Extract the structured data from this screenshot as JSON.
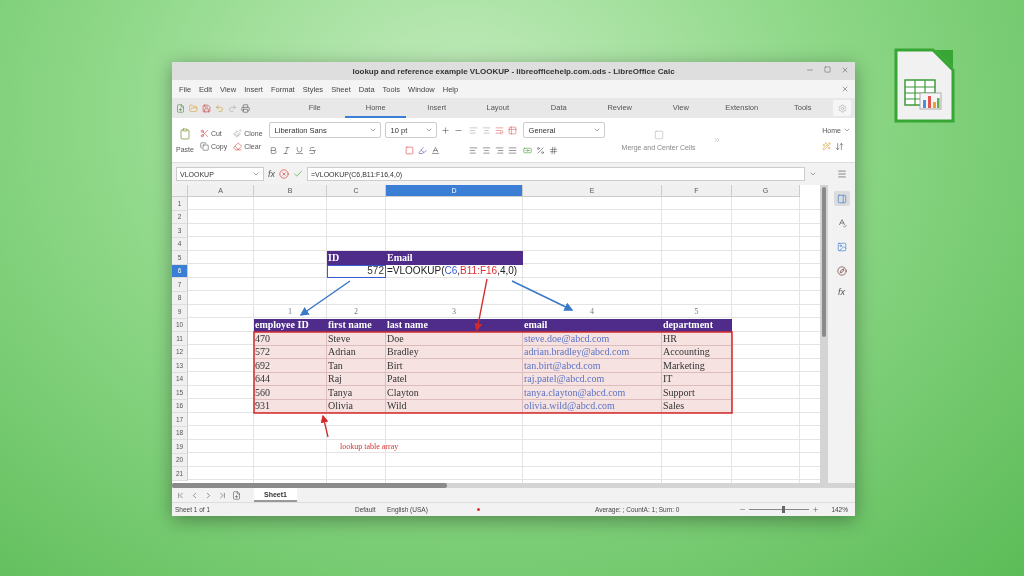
{
  "window": {
    "title": "lookup and reference example VLOOKUP - libreofficehelp.com.ods - LibreOffice Calc"
  },
  "menu": [
    "File",
    "Edit",
    "View",
    "Insert",
    "Format",
    "Styles",
    "Sheet",
    "Data",
    "Tools",
    "Window",
    "Help"
  ],
  "ribbon_tabs": [
    {
      "label": "File",
      "selected": false
    },
    {
      "label": "Home",
      "selected": true
    },
    {
      "label": "Insert",
      "selected": false
    },
    {
      "label": "Layout",
      "selected": false
    },
    {
      "label": "Data",
      "selected": false
    },
    {
      "label": "Review",
      "selected": false
    },
    {
      "label": "View",
      "selected": false
    },
    {
      "label": "Extension",
      "selected": false
    },
    {
      "label": "Tools",
      "selected": false
    }
  ],
  "ribbon": {
    "paste": "Paste",
    "cut": "Cut",
    "copy": "Copy",
    "clone": "Clone",
    "clear": "Clear",
    "font": "Liberation Sans",
    "size": "10 pt",
    "number_format": "General",
    "merge": "Merge and Center Cells",
    "context": "Home"
  },
  "formula_bar": {
    "name_box": "VLOOKUP",
    "function_label": "fx",
    "formula": "=VLOOKUP(C6,B11:F16,4,0)"
  },
  "sidebar": {
    "function_label": "fx"
  },
  "columns": [
    {
      "label": "A",
      "selected": false
    },
    {
      "label": "B",
      "selected": false
    },
    {
      "label": "C",
      "selected": false
    },
    {
      "label": "D",
      "selected": true
    },
    {
      "label": "E",
      "selected": false
    },
    {
      "label": "F",
      "selected": false
    },
    {
      "label": "G",
      "selected": false
    }
  ],
  "rows": [
    {
      "label": "1",
      "selected": false
    },
    {
      "label": "2",
      "selected": false
    },
    {
      "label": "3",
      "selected": false
    },
    {
      "label": "4",
      "selected": false
    },
    {
      "label": "5",
      "selected": false,
      "cells": [
        null,
        null,
        {
          "kind": "header",
          "text": "ID"
        },
        {
          "kind": "header",
          "text": "Email"
        },
        null,
        null,
        null
      ]
    },
    {
      "label": "6",
      "selected": true,
      "cells": [
        null,
        null,
        {
          "kind": "reference",
          "text": "572"
        },
        {
          "kind": "formula",
          "parts": [
            {
              "text": "=VLOOKUP("
            },
            {
              "text": "C6",
              "color": "#3b5bd0"
            },
            {
              "text": ","
            },
            {
              "text": "B11:F16",
              "color": "#e03030"
            },
            {
              "text": ",4,0)"
            }
          ]
        },
        null,
        null,
        null
      ]
    },
    {
      "label": "7",
      "selected": false
    },
    {
      "label": "8",
      "selected": false
    },
    {
      "label": "9",
      "selected": false,
      "cells": [
        null,
        {
          "kind": "label",
          "text": "1"
        },
        {
          "kind": "label",
          "text": "2"
        },
        {
          "kind": "label",
          "text": "3"
        },
        {
          "kind": "label",
          "text": "4"
        },
        {
          "kind": "label",
          "text": "5"
        },
        null
      ]
    },
    {
      "label": "10",
      "selected": false,
      "cells": [
        null,
        {
          "kind": "header",
          "text": "employee ID"
        },
        {
          "kind": "header",
          "text": "first name"
        },
        {
          "kind": "header",
          "text": "last name"
        },
        {
          "kind": "header",
          "text": "email"
        },
        {
          "kind": "header",
          "text": "department"
        },
        null
      ]
    },
    {
      "label": "11",
      "selected": false,
      "cells": [
        null,
        {
          "kind": "value",
          "text": "470"
        },
        {
          "kind": "value",
          "text": "Steve"
        },
        {
          "kind": "value",
          "text": "Doe"
        },
        {
          "kind": "link",
          "text": "steve.doe@abcd.com"
        },
        {
          "kind": "value",
          "text": "HR"
        },
        null
      ]
    },
    {
      "label": "12",
      "selected": false,
      "cells": [
        null,
        {
          "kind": "value",
          "text": "572"
        },
        {
          "kind": "value",
          "text": "Adrian"
        },
        {
          "kind": "value",
          "text": "Bradley"
        },
        {
          "kind": "link",
          "text": "adrian.bradley@abcd.com"
        },
        {
          "kind": "value",
          "text": "Accounting"
        },
        null
      ]
    },
    {
      "label": "13",
      "selected": false,
      "cells": [
        null,
        {
          "kind": "value",
          "text": "692"
        },
        {
          "kind": "value",
          "text": "Tan"
        },
        {
          "kind": "value",
          "text": "Birt"
        },
        {
          "kind": "link",
          "text": "tan.birt@abcd.com"
        },
        {
          "kind": "value",
          "text": "Marketing"
        },
        null
      ]
    },
    {
      "label": "14",
      "selected": false,
      "cells": [
        null,
        {
          "kind": "value",
          "text": "644"
        },
        {
          "kind": "value",
          "text": "Raj"
        },
        {
          "kind": "value",
          "text": "Patel"
        },
        {
          "kind": "link",
          "text": "raj.patel@abcd.com"
        },
        {
          "kind": "value",
          "text": "IT"
        },
        null
      ]
    },
    {
      "label": "15",
      "selected": false,
      "cells": [
        null,
        {
          "kind": "value",
          "text": "560"
        },
        {
          "kind": "value",
          "text": "Tanya"
        },
        {
          "kind": "value",
          "text": "Clayton"
        },
        {
          "kind": "link",
          "text": "tanya.clayton@abcd.com"
        },
        {
          "kind": "value",
          "text": "Support"
        },
        null
      ]
    },
    {
      "label": "16",
      "selected": false,
      "cells": [
        null,
        {
          "kind": "value",
          "text": "931"
        },
        {
          "kind": "value",
          "text": "Olivia"
        },
        {
          "kind": "value",
          "text": "Wild"
        },
        {
          "kind": "link",
          "text": "olivia.wild@abcd.com"
        },
        {
          "kind": "value",
          "text": "Sales"
        },
        null
      ]
    },
    {
      "label": "17",
      "selected": false
    },
    {
      "label": "18",
      "selected": false
    },
    {
      "label": "19",
      "selected": false,
      "cells": [
        null,
        null,
        {
          "kind": "note",
          "text": "lookup table array"
        },
        null,
        null,
        null,
        null
      ]
    },
    {
      "label": "20",
      "selected": false
    },
    {
      "label": "21",
      "selected": false
    }
  ],
  "sheet_tabs": [
    {
      "label": "Sheet1",
      "selected": true
    }
  ],
  "status_bar": {
    "sheet": "Sheet 1 of 1",
    "style": "Default",
    "language": "English (USA)",
    "summary": "Average: ; CountA: 1; Sum: 0",
    "zoom_slider": {
      "level": 0.55
    },
    "zoom": "142%"
  }
}
